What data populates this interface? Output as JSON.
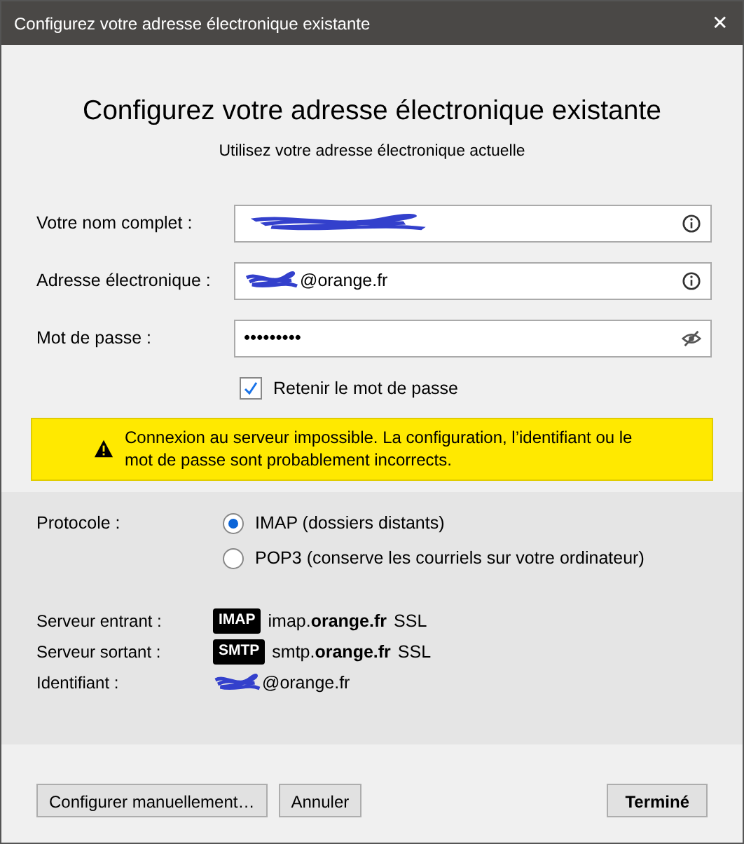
{
  "window": {
    "title": "Configurez votre adresse électronique existante",
    "close": "✕"
  },
  "heading": "Configurez votre adresse électronique existante",
  "subheading": "Utilisez votre adresse électronique actuelle",
  "fields": [
    {
      "label": "Votre nom complet :",
      "kind": "redacted",
      "action": {
        "kind": "info"
      }
    },
    {
      "label": "Adresse électronique :",
      "kind": "redacted-prefix",
      "value": "@orange.fr",
      "action": {
        "kind": "info"
      }
    },
    {
      "label": "Mot de passe :",
      "kind": "password",
      "value": "•••••••••",
      "action": {
        "kind": "reveal"
      }
    }
  ],
  "remember": {
    "label": "Retenir le mot de passe",
    "checked": true
  },
  "warning": {
    "text": "Connexion au serveur impossible. La configuration, l’identifiant ou le mot de passe sont probablement incorrects."
  },
  "protocol": {
    "label": "Protocole :",
    "options": [
      {
        "label": "IMAP (dossiers distants)",
        "selected": true
      },
      {
        "label": "POP3 (conserve les courriels sur votre ordinateur)",
        "selected": false
      }
    ]
  },
  "servers": [
    {
      "label": "Serveur entrant :",
      "badge": "IMAP",
      "host": "imap.**orange.fr**",
      "security": "SSL"
    },
    {
      "label": "Serveur sortant :",
      "badge": "SMTP",
      "host": "smtp.**orange.fr**",
      "security": "SSL"
    }
  ],
  "identifier": {
    "label": "Identifiant :",
    "value": "@orange.fr"
  },
  "buttons": [
    {
      "label": "Configurer manuellement…",
      "kind": "normal"
    },
    {
      "label": "Annuler",
      "kind": "normal"
    },
    {
      "label": "Terminé",
      "kind": "default"
    }
  ]
}
